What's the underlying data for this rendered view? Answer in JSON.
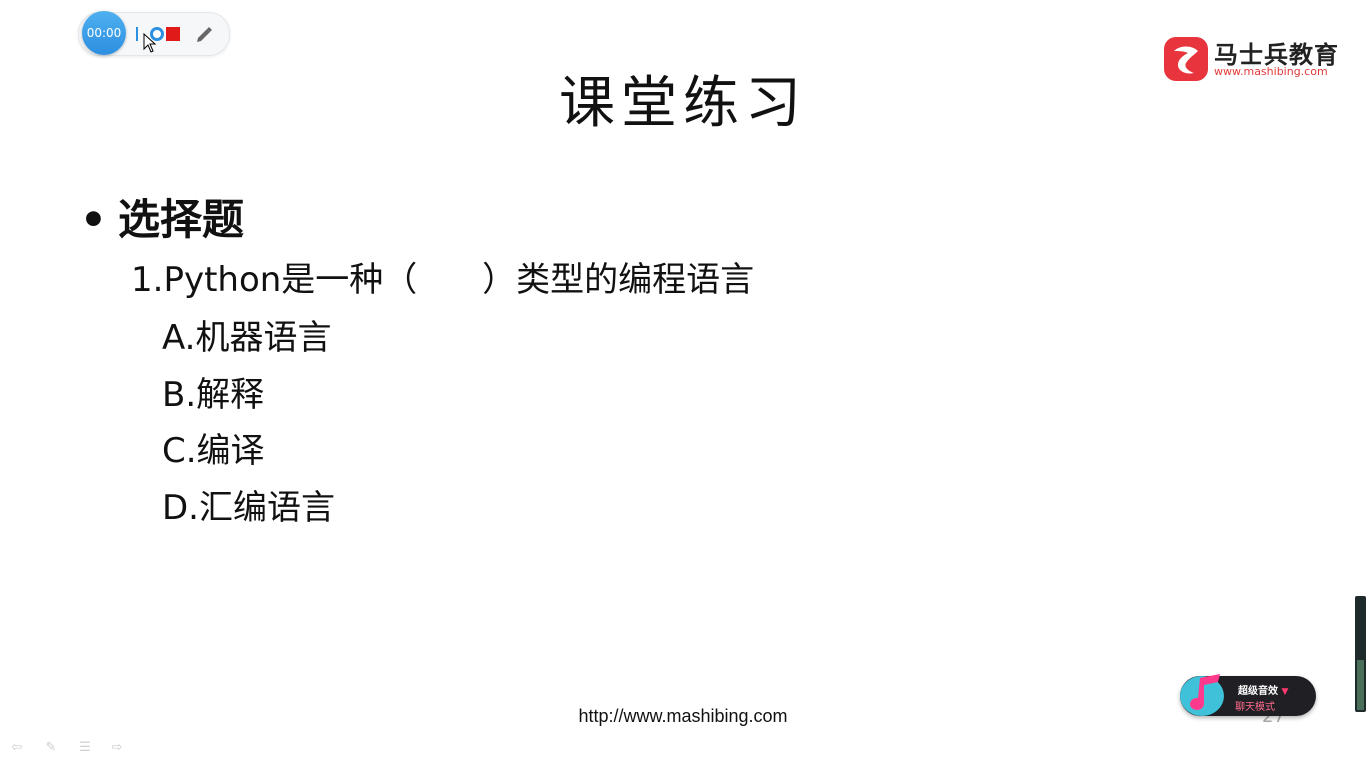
{
  "recorder": {
    "timer": "00:00",
    "colors": {
      "accent": "#2c8fe0",
      "stop": "#e01919"
    }
  },
  "logo": {
    "name": "马士兵教育",
    "url": "www.mashibing.com",
    "color": "#e23b3b"
  },
  "slide": {
    "title": "课堂练习",
    "bullet": "•",
    "section": "选择题",
    "question": "1.Python是一种（      ）类型的编程语言",
    "options": [
      "A.机器语言",
      "B.解释",
      "C.编译",
      "D.汇编语言"
    ],
    "footer_url": "http://www.mashibing.com",
    "page_number": "27"
  },
  "music_widget": {
    "label": "超级音效",
    "arrow": "▼",
    "mode": "聊天模式"
  },
  "level_meter": {
    "level": 0.45
  },
  "nav": {
    "icons": [
      "arrow-left-icon",
      "pen-icon",
      "menu-icon",
      "arrow-right-icon"
    ],
    "glyphs": [
      "⇦",
      "✎",
      "☰",
      "⇨"
    ]
  }
}
